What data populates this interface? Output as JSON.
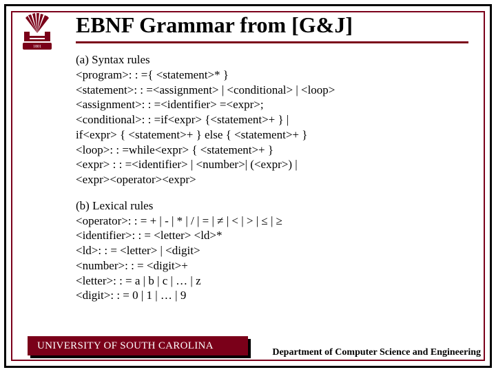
{
  "title": "EBNF Grammar from [G&J]",
  "sections": {
    "syntax": {
      "heading": "(a) Syntax rules",
      "rules": [
        "<program>: : ={ <statement>* }",
        "<statement>: : =<assignment> | <conditional> | <loop>",
        "<assignment>: : =<identifier> =<expr>;",
        "<conditional>: : =if<expr> {<statement>+ } |",
        "if<expr> { <statement>+ } else { <statement>+ }",
        "<loop>: : =while<expr> { <statement>+ }",
        "<expr> : : =<identifier> | <number>| (<expr>) |",
        "<expr><operator><expr>"
      ]
    },
    "lexical": {
      "heading": "(b) Lexical rules",
      "rules": [
        "<operator>: : = + | - | * | / | = | ≠ | < | > | ≤ | ≥",
        "<identifier>: : = <letter> <ld>*",
        "<ld>: : = <letter> | <digit>",
        "<number>: : = <digit>+",
        "<letter>: : = a | b | c | … | z",
        "<digit>: : = 0 | 1 | … | 9"
      ]
    }
  },
  "footer": {
    "university": "UNIVERSITY OF SOUTH CAROLINA",
    "department": "Department of Computer Science and Engineering"
  },
  "logo_alt": "University of South Carolina seal"
}
